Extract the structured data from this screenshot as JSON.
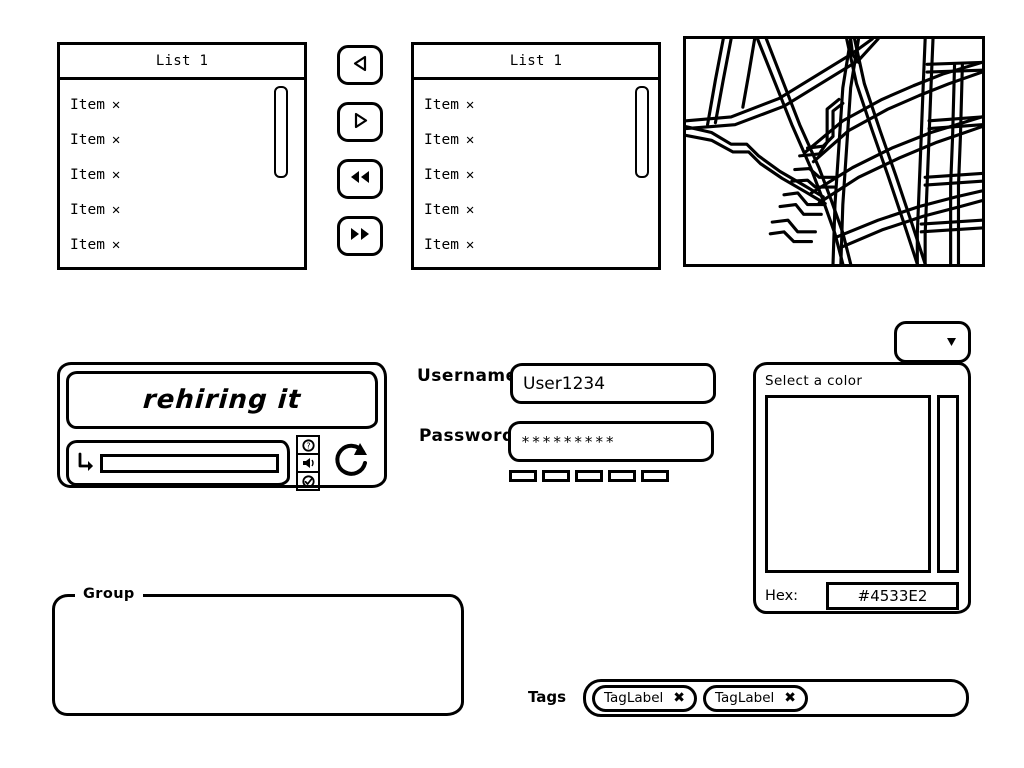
{
  "lists": [
    {
      "title": "List 1",
      "items": [
        {
          "label": "Item",
          "remove": "✕"
        },
        {
          "label": "Item",
          "remove": "✕"
        },
        {
          "label": "Item",
          "remove": "✕"
        },
        {
          "label": "Item",
          "remove": "✕"
        },
        {
          "label": "Item",
          "remove": "✕"
        }
      ]
    },
    {
      "title": "List 1",
      "items": [
        {
          "label": "Item",
          "remove": "✕"
        },
        {
          "label": "Item",
          "remove": "✕"
        },
        {
          "label": "Item",
          "remove": "✕"
        },
        {
          "label": "Item",
          "remove": "✕"
        },
        {
          "label": "Item",
          "remove": "✕"
        }
      ]
    }
  ],
  "transfer_buttons": [
    {
      "icon": "triangle-left-icon",
      "name": "move-left-button"
    },
    {
      "icon": "triangle-right-icon",
      "name": "move-right-button"
    },
    {
      "icon": "double-triangle-left-icon",
      "name": "move-all-left-button"
    },
    {
      "icon": "double-triangle-right-icon",
      "name": "move-all-right-button"
    }
  ],
  "map": {
    "name": "street-map",
    "style": "sketch-street-map"
  },
  "captcha": {
    "challenge_text": "rehiring  it",
    "input_value": "",
    "enter_icon": "enter-arrow-icon",
    "refresh_icon": "refresh-icon",
    "side_icons": [
      "help-icon",
      "audio-icon",
      "confirm-icon"
    ]
  },
  "form": {
    "username_label": "Username:",
    "username_value": "User1234",
    "password_label": "Password:",
    "password_value": "*********",
    "strength_segments": 5
  },
  "color_picker": {
    "dropdown_icon": "chevron-down-icon",
    "dropdown_value": "",
    "title": "Select a color",
    "hex_label": "Hex:",
    "hex_value": "#4533E2"
  },
  "group": {
    "legend": "Group"
  },
  "tags": {
    "label": "Tags",
    "chips": [
      {
        "label": "TagLabel",
        "remove": "✖"
      },
      {
        "label": "TagLabel",
        "remove": "✖"
      }
    ]
  }
}
